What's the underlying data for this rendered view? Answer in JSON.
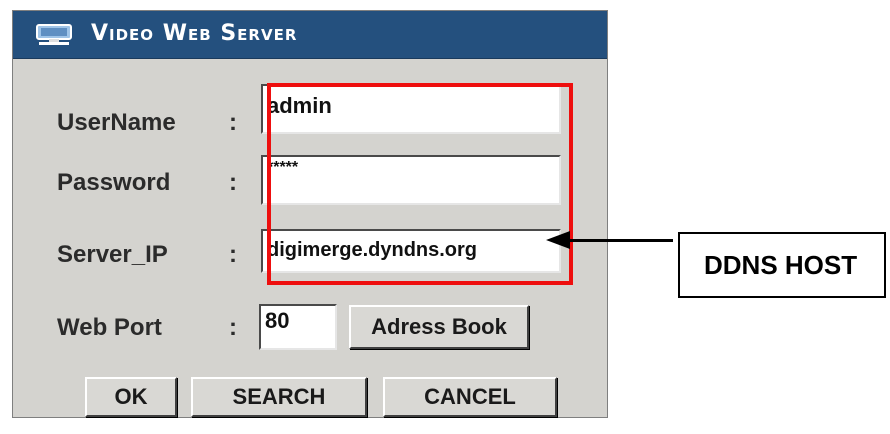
{
  "window": {
    "title": "Video Web Server",
    "icon": "network-computer-icon"
  },
  "form": {
    "username": {
      "label": "UserName",
      "colon": ":",
      "value": "admin"
    },
    "password": {
      "label": "Password",
      "colon": ":",
      "value": "*****"
    },
    "server_ip": {
      "label": "Server_IP",
      "colon": ":",
      "value": "digimerge.dyndns.org"
    },
    "web_port": {
      "label": "Web Port",
      "colon": ":",
      "value": "80"
    }
  },
  "buttons": {
    "address_book": "Adress Book",
    "ok": "OK",
    "search": "SEARCH",
    "cancel": "CANCEL"
  },
  "annotation": {
    "text": "DDNS HOST"
  },
  "colors": {
    "titlebar": "#24507e",
    "dialog_bg": "#d4d3cf",
    "highlight": "#ee0e0e"
  }
}
